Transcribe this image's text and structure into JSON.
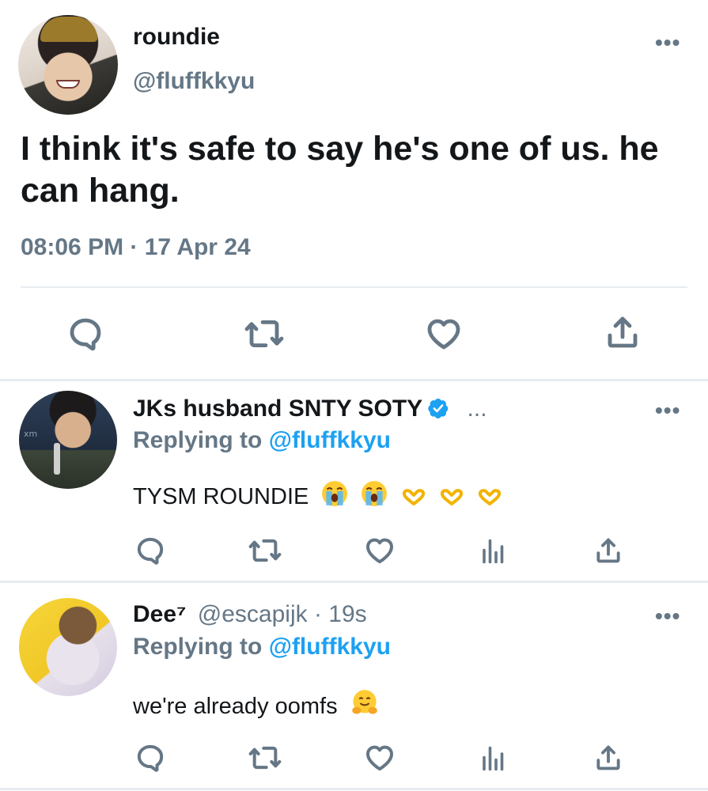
{
  "main_tweet": {
    "display_name": "roundie",
    "handle": "@fluffkkyu",
    "text": "I think it's safe to say he's one of us. he can hang.",
    "timestamp": "08:06 PM · 17 Apr 24",
    "more_label": "•••",
    "avatar_icon": "profile-photo-avatar",
    "actions": [
      "reply-icon",
      "retweet-icon",
      "like-icon",
      "share-icon"
    ]
  },
  "replies": [
    {
      "display_name": "JKs husband SNTY SOTY",
      "handle_suffix": "...",
      "verified": true,
      "replying_prefix": "Replying to",
      "replying_to": "@fluffkkyu",
      "text": "TYSM ROUNDIE",
      "emojis": [
        "loudly-crying-face",
        "loudly-crying-face",
        "heart-hands",
        "heart-hands",
        "heart-hands"
      ],
      "more_label": "•••",
      "actions": [
        "reply-icon",
        "retweet-icon",
        "like-icon",
        "analytics-icon",
        "share-icon"
      ]
    },
    {
      "display_name": "Dee⁷",
      "handle": "@escapijk · 19s",
      "replying_prefix": "Replying to",
      "replying_to": "@fluffkkyu",
      "text": "we're already oomfs",
      "emojis": [
        "hugging-face"
      ],
      "more_label": "•••",
      "actions": [
        "reply-icon",
        "retweet-icon",
        "like-icon",
        "analytics-icon",
        "share-icon"
      ]
    }
  ],
  "colors": {
    "text": "#14171a",
    "secondary": "#657786",
    "link": "#1da1f2",
    "divider": "#e6ecf0",
    "verified": "#1da1f2"
  }
}
